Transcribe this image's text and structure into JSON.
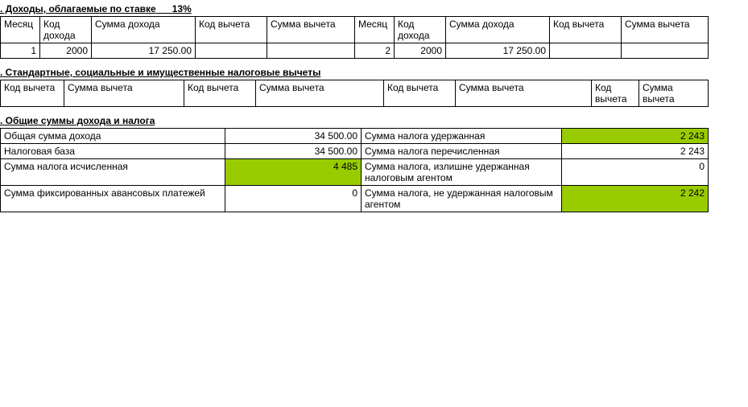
{
  "s3": {
    "title": ". Доходы, облагаемые по ставке",
    "rate": "13%",
    "cols": {
      "month": "Месяц",
      "incCode": "Код дохода",
      "incSum": "Сумма дохода",
      "dedCode": "Код вычета",
      "dedSum": "Сумма вычета"
    },
    "row1": {
      "month": "1",
      "incCode": "2000",
      "incSum": "17 250.00",
      "dedCode": "",
      "dedSum": "",
      "month2": "2",
      "incCode2": "2000",
      "incSum2": "17 250.00",
      "dedCode2": "",
      "dedSum2": ""
    }
  },
  "s4": {
    "title": ". Стандартные, социальные и имущественные налоговые вычеты",
    "cols": {
      "dedCode": "Код вычета",
      "dedSum": "Сумма вычета"
    }
  },
  "s5": {
    "title": ". Общие суммы дохода и налога",
    "rows": {
      "totalIncomeLabel": "Общая сумма дохода",
      "totalIncomeVal": "34 500.00",
      "taxWithheldLabel": "Сумма налога удержанная",
      "taxWithheldVal": "2 243",
      "taxBaseLabel": "Налоговая база",
      "taxBaseVal": "34 500.00",
      "taxTransferredLabel": "Сумма налога перечисленная",
      "taxTransferredVal": "2 243",
      "taxCalcLabel": "Сумма налога исчисленная",
      "taxCalcVal": "4 485",
      "taxExcessLabel": "Сумма налога, излишне удержанная налоговым агентом",
      "taxExcessVal": "0",
      "fixedAdvLabel": "Сумма фиксированных авансовых платежей",
      "fixedAdvVal": "0",
      "taxNotWithheldLabel": "Сумма налога, не удержанная налоговым агентом",
      "taxNotWithheldVal": "2 242"
    }
  }
}
